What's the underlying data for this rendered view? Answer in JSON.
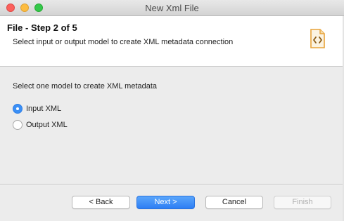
{
  "window": {
    "title": "New Xml File"
  },
  "banner": {
    "title": "File - Step 2 of 5",
    "description": "Select input or output model to create XML metadata connection",
    "icon": "xml-file-icon"
  },
  "content": {
    "prompt": "Select one model to create XML metadata",
    "options": [
      {
        "label": "Input XML",
        "selected": true
      },
      {
        "label": "Output XML",
        "selected": false
      }
    ]
  },
  "buttons": {
    "back": "< Back",
    "next": "Next >",
    "cancel": "Cancel",
    "finish": "Finish"
  },
  "colors": {
    "accent": "#3b8ff5",
    "close": "#fc605c",
    "minimize": "#fdbc40",
    "maximize": "#34c84a",
    "icon_orange": "#e8a33a"
  }
}
